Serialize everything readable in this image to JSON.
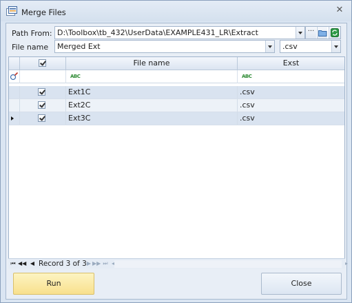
{
  "window": {
    "title": "Merge Files",
    "close_glyph": "✕"
  },
  "form": {
    "path_label": "Path From:",
    "path_value": "D:\\Toolbox\\tb_432\\UserData\\EXAMPLE431_LR\\Extract",
    "browse_glyph": "···",
    "filename_label": "File name",
    "filename_value": "Merged Ext",
    "extension_value": ".csv"
  },
  "grid": {
    "headers": {
      "filename": "File name",
      "ext": "Exst"
    },
    "filter_glyph": "ABC",
    "rows": [
      {
        "checked": true,
        "filename": "Ext1C",
        "ext": ".csv",
        "current": false
      },
      {
        "checked": true,
        "filename": "Ext2C",
        "ext": ".csv",
        "current": false
      },
      {
        "checked": true,
        "filename": "Ext3C",
        "ext": ".csv",
        "current": true
      }
    ]
  },
  "navigator": {
    "record_text": "Record 3 of 3"
  },
  "buttons": {
    "run": "Run",
    "close": "Close"
  },
  "colors": {
    "run_button": "#f8e08d",
    "selection_row": "#d9e3f0"
  }
}
